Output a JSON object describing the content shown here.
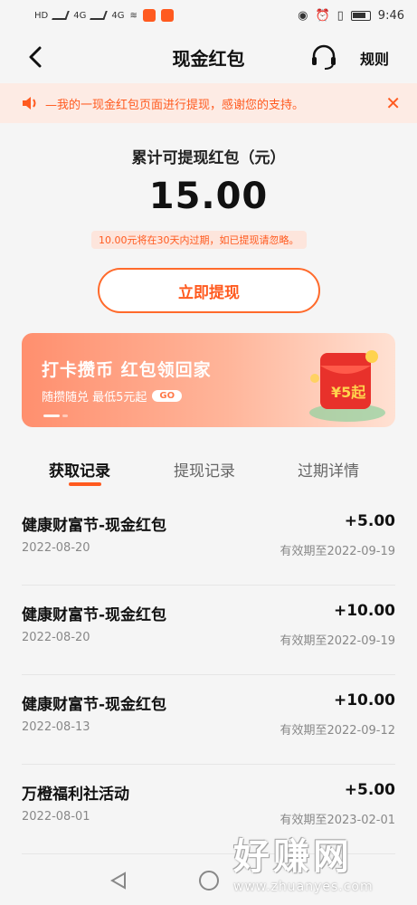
{
  "status_bar": {
    "time": "9:46",
    "left_labels": [
      "HD",
      "4G",
      "4G"
    ]
  },
  "nav": {
    "title": "现金红包",
    "rules": "规则"
  },
  "notice": {
    "text": "⁠—我的一现金红包页面进行提现，感谢您的支持。"
  },
  "balance": {
    "label": "累计可提现红包（元）",
    "amount": "15.00",
    "expire_tip": "10.00元将在30天内过期，如已提现请忽略。",
    "withdraw_button": "立即提现"
  },
  "banner": {
    "title": "打卡攒币 红包领回家",
    "subtitle": "随攒随兑 最低5元起",
    "go_label": "GO",
    "badge_text": "¥5起"
  },
  "tabs": [
    {
      "label": "获取记录",
      "active": true
    },
    {
      "label": "提现记录",
      "active": false
    },
    {
      "label": "过期详情",
      "active": false
    }
  ],
  "records": [
    {
      "title": "健康财富节-现金红包",
      "amount": "+5.00",
      "date": "2022-08-20",
      "expire": "有效期至2022-09-19"
    },
    {
      "title": "健康财富节-现金红包",
      "amount": "+10.00",
      "date": "2022-08-20",
      "expire": "有效期至2022-09-19"
    },
    {
      "title": "健康财富节-现金红包",
      "amount": "+10.00",
      "date": "2022-08-13",
      "expire": "有效期至2022-09-12"
    },
    {
      "title": "万橙福利社活动",
      "amount": "+5.00",
      "date": "2022-08-01",
      "expire": "有效期至2023-02-01"
    }
  ],
  "watermark": {
    "main": "好赚网",
    "url": "www.zhuanyes.com"
  },
  "colors": {
    "accent": "#ff5a1f",
    "notice_bg": "#fdebe4",
    "page_bg": "#f5f5f5"
  }
}
